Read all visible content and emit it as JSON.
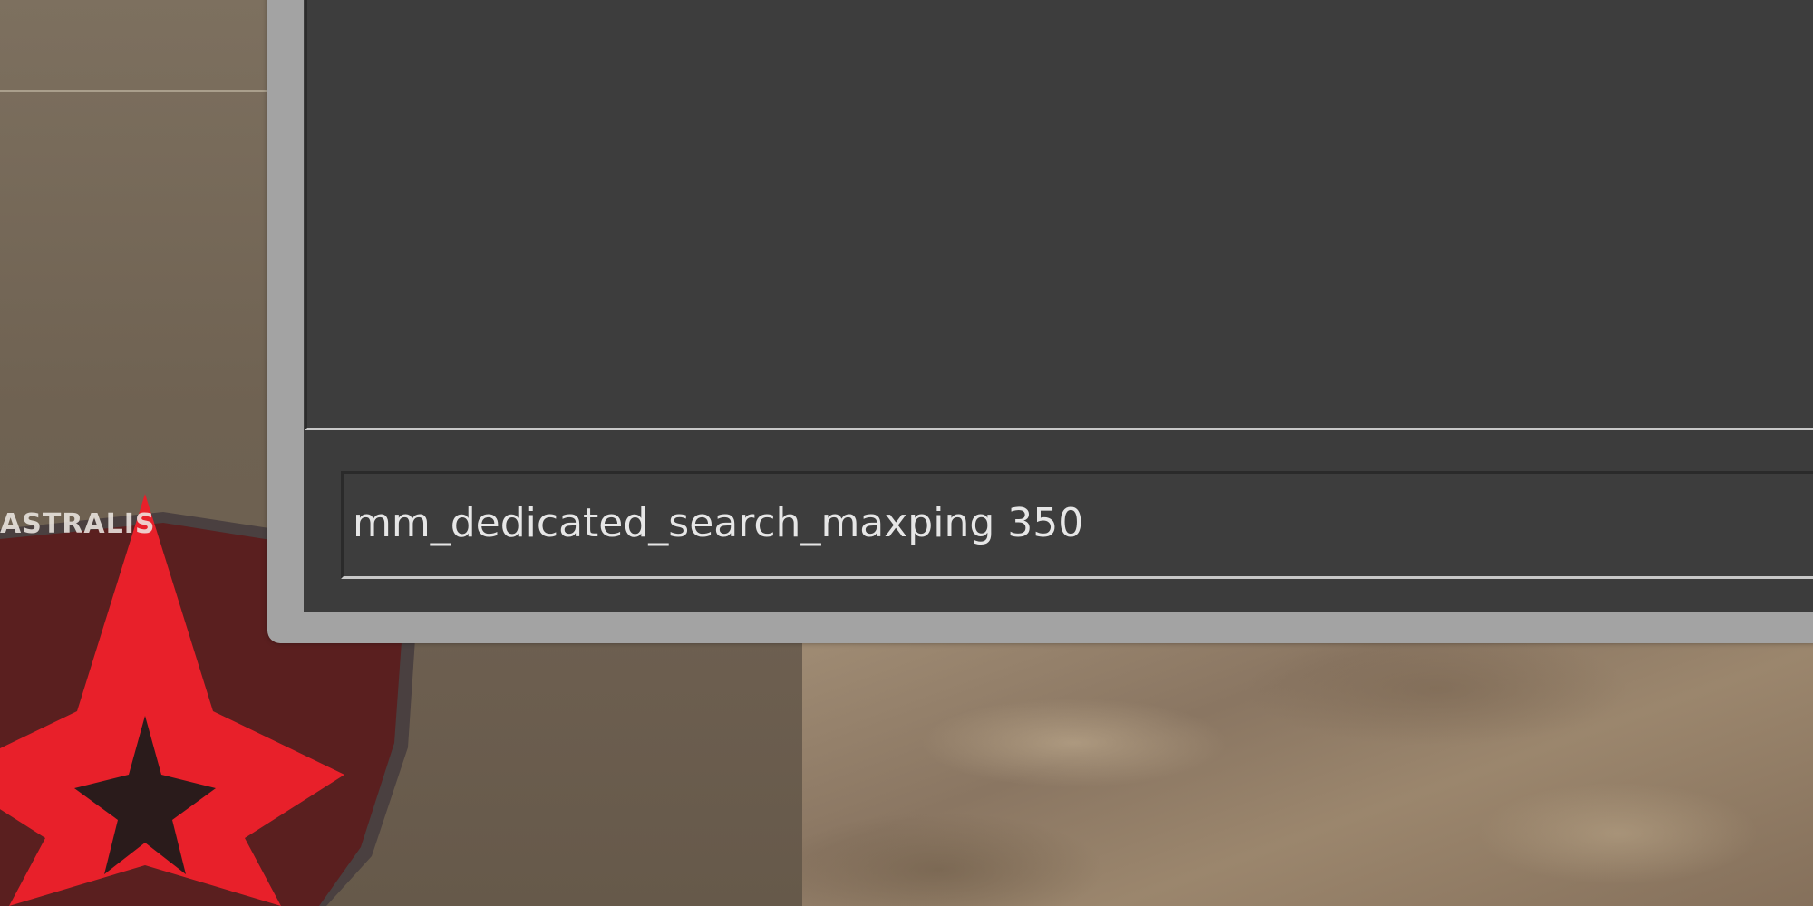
{
  "console": {
    "input_value": "mm_dedicated_search_maxping 350"
  },
  "sticker": {
    "text": "ASTRALIS"
  },
  "colors": {
    "console_bg": "#3d3d3d",
    "console_frame": "#a3a3a3",
    "console_text": "#e6e6e6",
    "sticker_red": "#e8202a",
    "sticker_dark": "#2a2020"
  }
}
